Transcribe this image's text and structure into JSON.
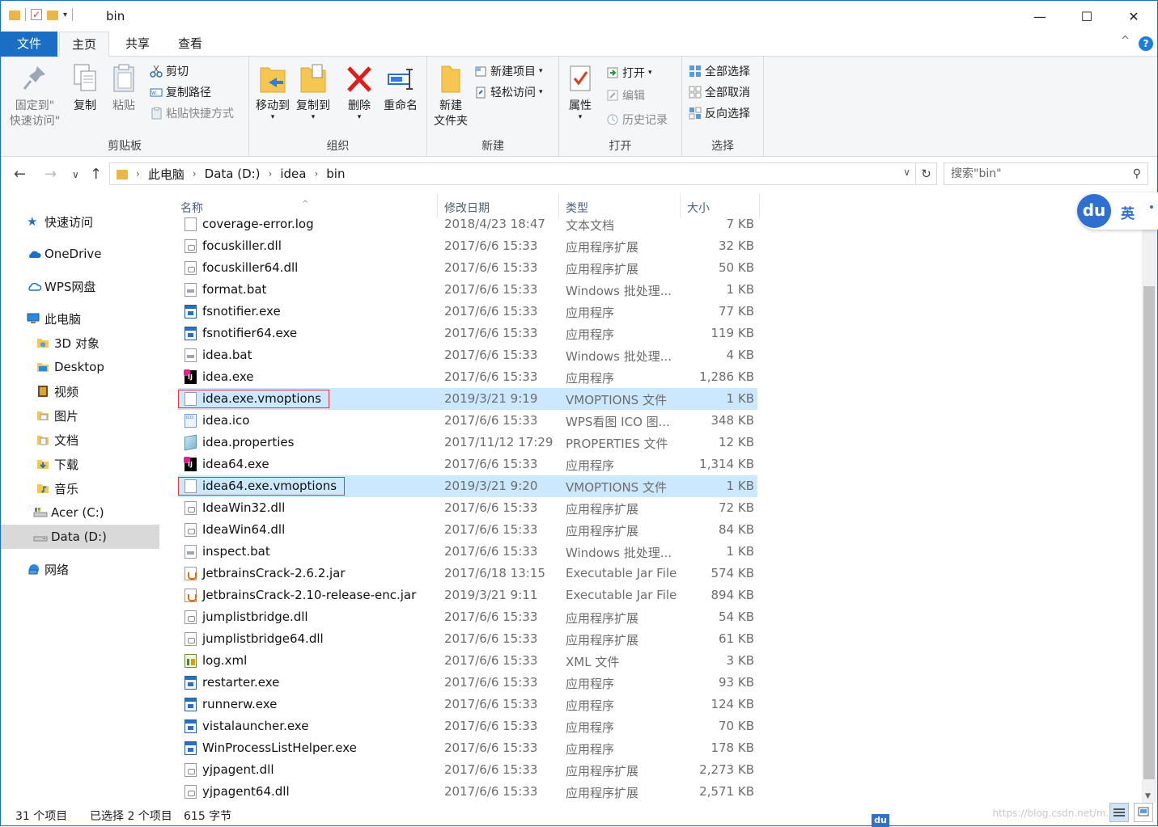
{
  "window": {
    "title": "bin",
    "minimize": "—",
    "maximize": "☐",
    "close": "✕"
  },
  "tabs": {
    "file": "文件",
    "home": "主页",
    "share": "共享",
    "view": "查看",
    "collapse": "^",
    "help": "?"
  },
  "ribbon": {
    "clipboard": {
      "label": "剪贴板",
      "pin": "固定到\"\n快速访问\"",
      "pin_line1": "固定到\"",
      "pin_line2": "快速访问\"",
      "copy": "复制",
      "paste": "粘贴",
      "cut": "剪切",
      "copy_path": "复制路径",
      "paste_shortcut": "粘贴快捷方式"
    },
    "organize": {
      "label": "组织",
      "move_to": "移动到",
      "copy_to": "复制到",
      "delete": "删除",
      "rename": "重命名"
    },
    "new": {
      "label": "新建",
      "new_folder_line1": "新建",
      "new_folder_line2": "文件夹",
      "new_item": "新建项目",
      "easy_access": "轻松访问"
    },
    "open": {
      "label": "打开",
      "properties": "属性",
      "open": "打开",
      "edit": "编辑",
      "history": "历史记录"
    },
    "select": {
      "label": "选择",
      "select_all": "全部选择",
      "select_none": "全部取消",
      "invert": "反向选择"
    }
  },
  "address": {
    "crumbs": [
      "此电脑",
      "Data (D:)",
      "idea",
      "bin"
    ],
    "search_placeholder": "搜索\"bin\""
  },
  "nav": {
    "items": [
      {
        "label": "快速访问",
        "icon": "star-icon"
      },
      {
        "label": "OneDrive",
        "icon": "cloud-icon"
      },
      {
        "label": "WPS网盘",
        "icon": "cloud-outline-icon"
      },
      {
        "label": "此电脑",
        "icon": "computer-icon"
      },
      {
        "label": "3D 对象",
        "icon": "folder-3d-icon"
      },
      {
        "label": "Desktop",
        "icon": "folder-icon"
      },
      {
        "label": "视频",
        "icon": "video-folder-icon"
      },
      {
        "label": "图片",
        "icon": "pictures-folder-icon"
      },
      {
        "label": "文档",
        "icon": "documents-folder-icon"
      },
      {
        "label": "下载",
        "icon": "download-folder-icon"
      },
      {
        "label": "音乐",
        "icon": "music-folder-icon"
      },
      {
        "label": "Acer (C:)",
        "icon": "drive-c-icon"
      },
      {
        "label": "Data (D:)",
        "icon": "drive-d-icon"
      },
      {
        "label": "网络",
        "icon": "network-icon"
      }
    ]
  },
  "columns": {
    "name": "名称",
    "date": "修改日期",
    "type": "类型",
    "size": "大小"
  },
  "files": [
    {
      "name": "coverage-error.log",
      "date": "2018/4/23 18:47",
      "type": "文本文档",
      "size": "7 KB",
      "icon": "doc"
    },
    {
      "name": "focuskiller.dll",
      "date": "2017/6/6 15:33",
      "type": "应用程序扩展",
      "size": "32 KB",
      "icon": "dll"
    },
    {
      "name": "focuskiller64.dll",
      "date": "2017/6/6 15:33",
      "type": "应用程序扩展",
      "size": "50 KB",
      "icon": "dll"
    },
    {
      "name": "format.bat",
      "date": "2017/6/6 15:33",
      "type": "Windows 批处理...",
      "size": "1 KB",
      "icon": "bat"
    },
    {
      "name": "fsnotifier.exe",
      "date": "2017/6/6 15:33",
      "type": "应用程序",
      "size": "77 KB",
      "icon": "exe"
    },
    {
      "name": "fsnotifier64.exe",
      "date": "2017/6/6 15:33",
      "type": "应用程序",
      "size": "119 KB",
      "icon": "exe"
    },
    {
      "name": "idea.bat",
      "date": "2017/6/6 15:33",
      "type": "Windows 批处理...",
      "size": "4 KB",
      "icon": "bat"
    },
    {
      "name": "idea.exe",
      "date": "2017/6/6 15:33",
      "type": "应用程序",
      "size": "1,286 KB",
      "icon": "idea"
    },
    {
      "name": "idea.exe.vmoptions",
      "date": "2019/3/21 9:19",
      "type": "VMOPTIONS 文件",
      "size": "1 KB",
      "icon": "doc",
      "selected": true
    },
    {
      "name": "idea.ico",
      "date": "2017/6/6 15:33",
      "type": "WPS看图 ICO 图...",
      "size": "348 KB",
      "icon": "ico"
    },
    {
      "name": "idea.properties",
      "date": "2017/11/12 17:29",
      "type": "PROPERTIES 文件",
      "size": "12 KB",
      "icon": "prop"
    },
    {
      "name": "idea64.exe",
      "date": "2017/6/6 15:33",
      "type": "应用程序",
      "size": "1,314 KB",
      "icon": "idea"
    },
    {
      "name": "idea64.exe.vmoptions",
      "date": "2019/3/21 9:20",
      "type": "VMOPTIONS 文件",
      "size": "1 KB",
      "icon": "doc",
      "selected": true
    },
    {
      "name": "IdeaWin32.dll",
      "date": "2017/6/6 15:33",
      "type": "应用程序扩展",
      "size": "72 KB",
      "icon": "dll"
    },
    {
      "name": "IdeaWin64.dll",
      "date": "2017/6/6 15:33",
      "type": "应用程序扩展",
      "size": "84 KB",
      "icon": "dll"
    },
    {
      "name": "inspect.bat",
      "date": "2017/6/6 15:33",
      "type": "Windows 批处理...",
      "size": "1 KB",
      "icon": "bat"
    },
    {
      "name": "JetbrainsCrack-2.6.2.jar",
      "date": "2017/6/18 13:15",
      "type": "Executable Jar File",
      "size": "574 KB",
      "icon": "jar"
    },
    {
      "name": "JetbrainsCrack-2.10-release-enc.jar",
      "date": "2019/3/21 9:11",
      "type": "Executable Jar File",
      "size": "894 KB",
      "icon": "jar"
    },
    {
      "name": "jumplistbridge.dll",
      "date": "2017/6/6 15:33",
      "type": "应用程序扩展",
      "size": "54 KB",
      "icon": "dll"
    },
    {
      "name": "jumplistbridge64.dll",
      "date": "2017/6/6 15:33",
      "type": "应用程序扩展",
      "size": "61 KB",
      "icon": "dll"
    },
    {
      "name": "log.xml",
      "date": "2017/6/6 15:33",
      "type": "XML 文件",
      "size": "3 KB",
      "icon": "xml"
    },
    {
      "name": "restarter.exe",
      "date": "2017/6/6 15:33",
      "type": "应用程序",
      "size": "93 KB",
      "icon": "exe"
    },
    {
      "name": "runnerw.exe",
      "date": "2017/6/6 15:33",
      "type": "应用程序",
      "size": "124 KB",
      "icon": "exe"
    },
    {
      "name": "vistalauncher.exe",
      "date": "2017/6/6 15:33",
      "type": "应用程序",
      "size": "70 KB",
      "icon": "exe"
    },
    {
      "name": "WinProcessListHelper.exe",
      "date": "2017/6/6 15:33",
      "type": "应用程序",
      "size": "178 KB",
      "icon": "exe"
    },
    {
      "name": "yjpagent.dll",
      "date": "2017/6/6 15:33",
      "type": "应用程序扩展",
      "size": "2,273 KB",
      "icon": "dll"
    },
    {
      "name": "yjpagent64.dll",
      "date": "2017/6/6 15:33",
      "type": "应用程序扩展",
      "size": "2,571 KB",
      "icon": "dll"
    }
  ],
  "status": {
    "count": "31 个项目",
    "selected": "已选择 2 个项目",
    "bytes": "615 字节",
    "watermark": "https://blog.csdn.net/m..."
  },
  "ime": {
    "logo": "du",
    "lang": "英"
  },
  "colors": {
    "accent": "#1a6fc4",
    "selection": "#cce8ff",
    "highlight_border": "#e0383e"
  }
}
